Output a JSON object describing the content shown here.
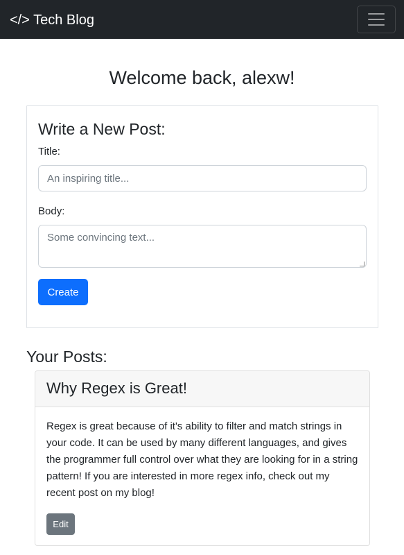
{
  "navbar": {
    "brand_icon": "</>",
    "brand_text": "Tech Blog",
    "toggler_icon": "hamburger-menu-icon",
    "background": "#212529"
  },
  "welcome": "Welcome back, alexw!",
  "new_post_form": {
    "heading": "Write a New Post:",
    "title_label": "Title:",
    "title_placeholder": "An inspiring title...",
    "title_value": "",
    "body_label": "Body:",
    "body_placeholder": "Some convincing text...",
    "body_value": "",
    "create_label": "Create",
    "create_color": "#0d6efd"
  },
  "posts": {
    "heading": "Your Posts:",
    "items": [
      {
        "title": "Why Regex is Great!",
        "body": "Regex is great because of it's ability to filter and match strings in your code. It can be used by many different languages, and gives the programmer full control over what they are looking for in a string pattern! If you are interested in more regex info, check out my recent post on my blog!",
        "edit_label": "Edit",
        "edit_color": "#6c757d"
      }
    ]
  }
}
